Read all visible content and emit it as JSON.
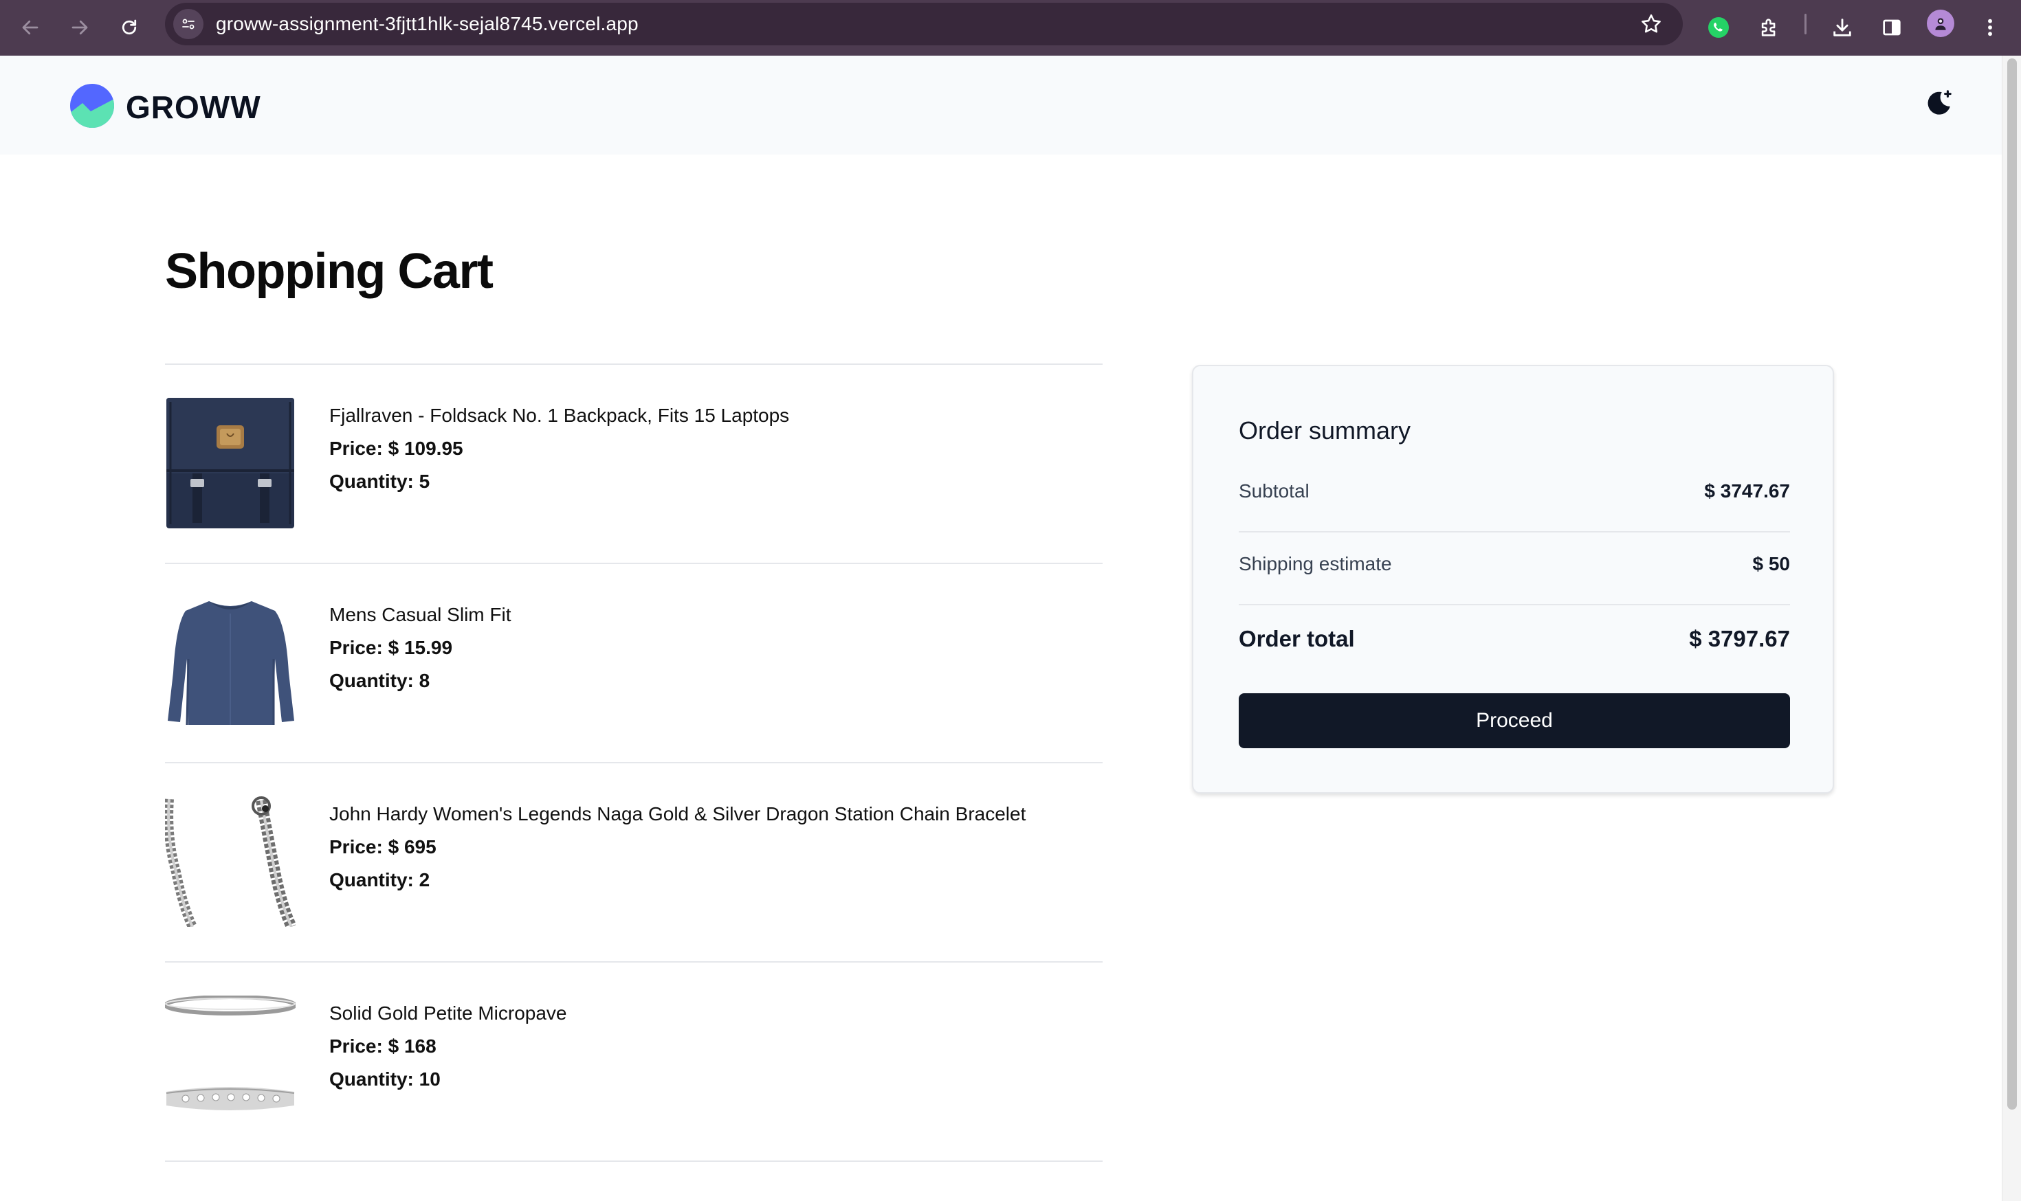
{
  "browser": {
    "url": "groww-assignment-3fjtt1hlk-sejal8745.vercel.app",
    "icons": [
      "back-arrow-icon",
      "forward-arrow-icon",
      "reload-icon",
      "site-info-icon",
      "bookmark-star-icon",
      "whatsapp-icon",
      "extensions-icon",
      "download-icon",
      "side-panel-icon",
      "profile-avatar-icon",
      "more-menu-icon"
    ]
  },
  "header": {
    "brand": "GROWW",
    "theme_toggle_icon": "moon-star-icon"
  },
  "page": {
    "title": "Shopping Cart"
  },
  "cart": {
    "price_label": "Price:",
    "quantity_label": "Quantity:",
    "items": [
      {
        "title": "Fjallraven - Foldsack No. 1 Backpack, Fits 15 Laptops",
        "price": "$ 109.95",
        "quantity": "5",
        "image_icon": "backpack-image"
      },
      {
        "title": "Mens Casual Slim Fit",
        "price": "$ 15.99",
        "quantity": "8",
        "image_icon": "shirt-image"
      },
      {
        "title": "John Hardy Women's Legends Naga Gold & Silver Dragon Station Chain Bracelet",
        "price": "$ 695",
        "quantity": "2",
        "image_icon": "bracelet-image"
      },
      {
        "title": "Solid Gold Petite Micropave",
        "price": "$ 168",
        "quantity": "10",
        "image_icon": "ring-image"
      }
    ]
  },
  "summary": {
    "title": "Order summary",
    "subtotal_label": "Subtotal",
    "subtotal_value": "$ 3747.67",
    "shipping_label": "Shipping estimate",
    "shipping_value": "$ 50",
    "total_label": "Order total",
    "total_value": "$ 3797.67",
    "proceed_label": "Proceed"
  },
  "colors": {
    "chrome_bg": "#4d3b50",
    "header_bg": "#f8fafc",
    "button_bg": "#111827",
    "divider": "#e5e7eb"
  }
}
